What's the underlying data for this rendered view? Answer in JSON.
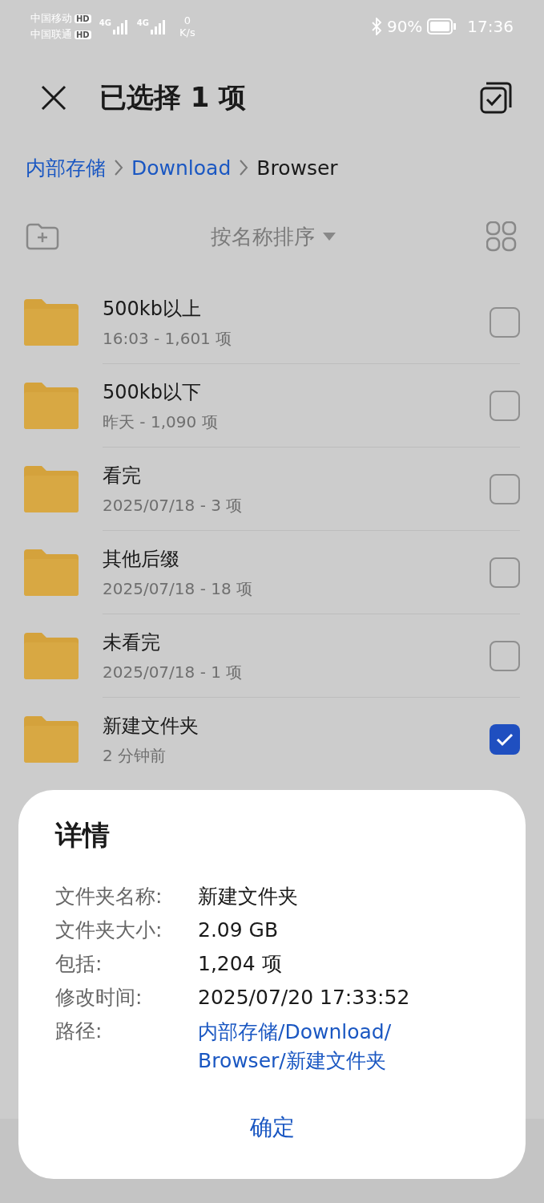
{
  "status_bar": {
    "carriers": [
      {
        "name": "中国移动",
        "badge": "HD"
      },
      {
        "name": "中国联通",
        "badge": "HD"
      }
    ],
    "networks": [
      "4G",
      "4G"
    ],
    "speed": {
      "value": "0",
      "unit": "K/s"
    },
    "battery": "90%",
    "time": "17:36"
  },
  "header": {
    "title": "已选择 1 项"
  },
  "breadcrumb": [
    {
      "label": "内部存储",
      "current": false
    },
    {
      "label": "Download",
      "current": false
    },
    {
      "label": "Browser",
      "current": true
    }
  ],
  "toolbar": {
    "sort": "按名称排序"
  },
  "folders": [
    {
      "name": "500kb以上",
      "meta": "16:03 - 1,601 项",
      "checked": false
    },
    {
      "name": "500kb以下",
      "meta": "昨天 - 1,090 项",
      "checked": false
    },
    {
      "name": "看完",
      "meta": "2025/07/18 - 3 项",
      "checked": false
    },
    {
      "name": "其他后缀",
      "meta": "2025/07/18 - 18 项",
      "checked": false
    },
    {
      "name": "未看完",
      "meta": "2025/07/18 - 1 项",
      "checked": false
    },
    {
      "name": "新建文件夹",
      "meta": "2 分钟前",
      "checked": true
    }
  ],
  "dialog": {
    "title": "详情",
    "rows": [
      {
        "label": "文件夹名称:",
        "value": "新建文件夹"
      },
      {
        "label": "文件夹大小:",
        "value": "2.09 GB"
      },
      {
        "label": "包括:",
        "value": "1,204 项"
      },
      {
        "label": "修改时间:",
        "value": "2025/07/20 17:33:52"
      }
    ],
    "path": {
      "label": "路径:",
      "lines": [
        "内部存储/Download/",
        "Browser/新建文件夹"
      ]
    },
    "confirm": "确定"
  }
}
